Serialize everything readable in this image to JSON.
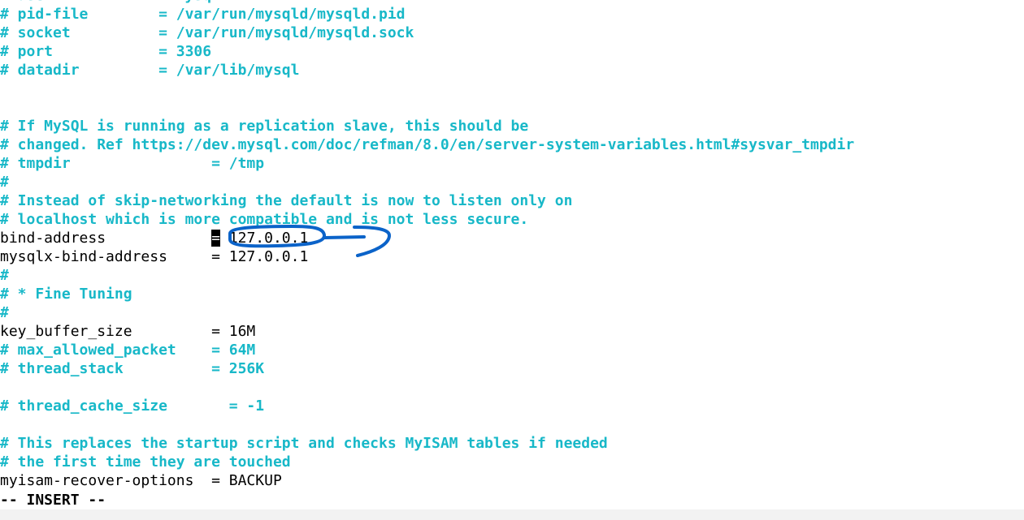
{
  "lines": [
    {
      "kind": "comment",
      "text": "# user            = mysql"
    },
    {
      "kind": "comment",
      "text": "# pid-file        = /var/run/mysqld/mysqld.pid"
    },
    {
      "kind": "comment",
      "text": "# socket          = /var/run/mysqld/mysqld.sock"
    },
    {
      "kind": "comment",
      "text": "# port            = 3306"
    },
    {
      "kind": "comment",
      "text": "# datadir         = /var/lib/mysql"
    },
    {
      "kind": "blank",
      "text": ""
    },
    {
      "kind": "blank",
      "text": ""
    },
    {
      "kind": "comment",
      "text": "# If MySQL is running as a replication slave, this should be"
    },
    {
      "kind": "comment",
      "text": "# changed. Ref https://dev.mysql.com/doc/refman/8.0/en/server-system-variables.html#sysvar_tmpdir"
    },
    {
      "kind": "comment",
      "text": "# tmpdir                = /tmp"
    },
    {
      "kind": "comment",
      "text": "#"
    },
    {
      "kind": "comment",
      "text": "# Instead of skip-networking the default is now to listen only on"
    },
    {
      "kind": "comment",
      "text": "# localhost which is more compatible and is not less secure."
    },
    {
      "kind": "cursor-setting",
      "before": "bind-address            ",
      "cursor_char": "=",
      "after": " 127.0.0.1"
    },
    {
      "kind": "setting",
      "text": "mysqlx-bind-address     = 127.0.0.1"
    },
    {
      "kind": "comment",
      "text": "#"
    },
    {
      "kind": "comment",
      "text": "# * Fine Tuning"
    },
    {
      "kind": "comment",
      "text": "#"
    },
    {
      "kind": "setting",
      "text": "key_buffer_size         = 16M"
    },
    {
      "kind": "comment",
      "text": "# max_allowed_packet    = 64M"
    },
    {
      "kind": "comment",
      "text": "# thread_stack          = 256K"
    },
    {
      "kind": "blank",
      "text": ""
    },
    {
      "kind": "comment",
      "text": "# thread_cache_size       = -1"
    },
    {
      "kind": "blank",
      "text": ""
    },
    {
      "kind": "comment",
      "text": "# This replaces the startup script and checks MyISAM tables if needed"
    },
    {
      "kind": "comment",
      "text": "# the first time they are touched"
    },
    {
      "kind": "setting",
      "text": "myisam-recover-options  = BACKUP"
    }
  ],
  "status": {
    "mode": "-- INSERT --"
  },
  "colors": {
    "comment": "#18b8c8",
    "text": "#000000",
    "annotation": "#0b63c9"
  },
  "annotation": {
    "shape": "hand-drawn-arrow",
    "target": "bind-address value"
  }
}
